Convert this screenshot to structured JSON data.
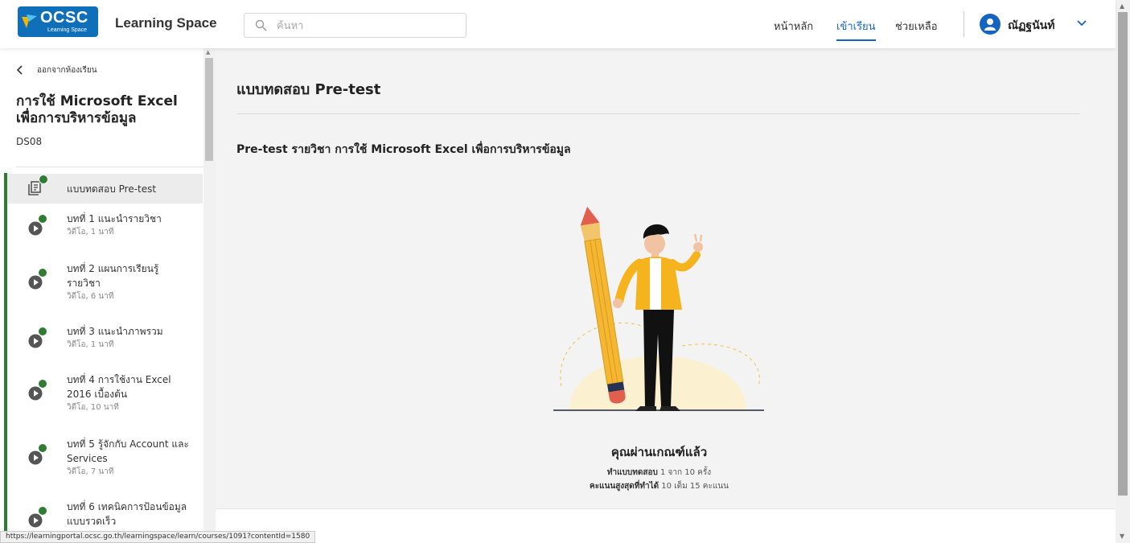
{
  "header": {
    "logo_text": "OCSC",
    "logo_sub": "Learning Space",
    "app_name": "Learning Space",
    "search_placeholder": "ค้นหา",
    "nav": {
      "home": "หน้าหลัก",
      "learn": "เข้าเรียน",
      "help": "ช่วยเหลือ"
    },
    "user_name": "ณัฏฐนันท์",
    "accent_color": "#1565c0"
  },
  "sidebar": {
    "back_label": "ออกจากห้องเรียน",
    "course_title": "การใช้ Microsoft Excel เพื่อการบริหารข้อมูล",
    "course_code": "DS08",
    "items": [
      {
        "title": "แบบทดสอบ Pre-test",
        "sub": ""
      },
      {
        "title": "บทที่ 1 แนะนำรายวิชา",
        "sub": "วิดีโอ, 1 นาที"
      },
      {
        "title": "บทที่ 2 แผนการเรียนรู้รายวิชา",
        "sub": "วิดีโอ, 6 นาที"
      },
      {
        "title": "บทที่ 3 แนะนำภาพรวม",
        "sub": "วิดีโอ, 1 นาที"
      },
      {
        "title": "บทที่ 4 การใช้งาน Excel 2016 เบื้องต้น",
        "sub": "วิดีโอ, 10 นาที"
      },
      {
        "title": "บทที่ 5 รู้จักกับ Account และ Services",
        "sub": "วิดีโอ, 7 นาที"
      },
      {
        "title": "บทที่ 6 เทคนิคการป้อนข้อมูลแบบรวดเร็ว",
        "sub": ""
      }
    ],
    "complete_color": "#2e7d32"
  },
  "main": {
    "title": "แบบทดสอบ Pre-test",
    "subtitle": "Pre-test รายวิชา การใช้ Microsoft Excel เพื่อการบริหารข้อมูล",
    "illustration_icon": "person-with-pencil-illustration",
    "pass_message": "คุณผ่านเกณฑ์แล้ว",
    "attempts_label": "ทำแบบทดสอบ",
    "attempts_value": "1 จาก 10 ครั้ง",
    "score_label": "คะแนนสูงสุดที่ทำได้",
    "score_value": "10 เต็ม 15 คะแนน"
  },
  "status_url": "https://learningportal.ocsc.go.th/learningspace/learn/courses/1091?contentId=1580"
}
